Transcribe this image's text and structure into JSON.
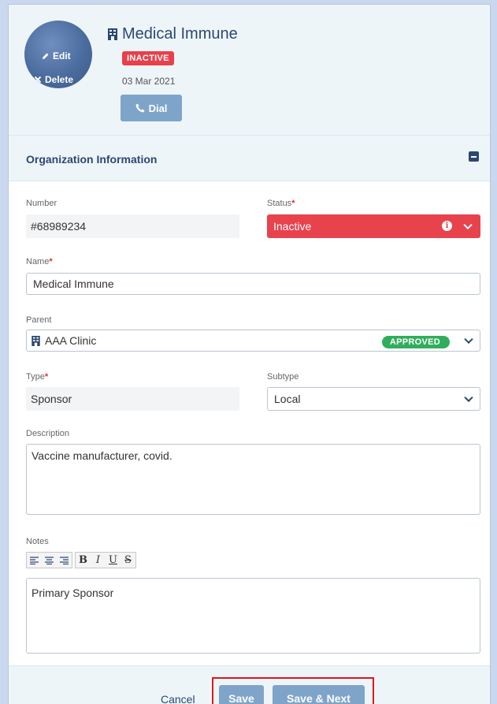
{
  "header": {
    "avatar": {
      "edit_label": "Edit",
      "delete_label": "Delete"
    },
    "org_name": "Medical Immune",
    "status_badge": "INACTIVE",
    "date": "03 Mar 2021",
    "dial_label": "Dial"
  },
  "section": {
    "title": "Organization Information"
  },
  "fields": {
    "number": {
      "label": "Number",
      "value": "#68989234"
    },
    "status": {
      "label": "Status",
      "required_mark": "*",
      "value": "Inactive",
      "info_glyph": "i"
    },
    "name": {
      "label": "Name",
      "required_mark": "*",
      "value": "Medical Immune"
    },
    "parent": {
      "label": "Parent",
      "value": "AAA Clinic",
      "badge": "APPROVED"
    },
    "type": {
      "label": "Type",
      "required_mark": "*",
      "value": "Sponsor"
    },
    "subtype": {
      "label": "Subtype",
      "value": "Local"
    },
    "description": {
      "label": "Description",
      "value": "Vaccine manufacturer, covid."
    },
    "notes": {
      "label": "Notes",
      "value": "Primary Sponsor",
      "toolbar": {
        "bold": "B",
        "italic": "I",
        "underline": "U",
        "strike": "S"
      }
    }
  },
  "footer": {
    "cancel_label": "Cancel",
    "save_label": "Save",
    "save_next_label": "Save & Next"
  },
  "colors": {
    "accent": "#2c4870",
    "button": "#7fa4c9",
    "danger": "#e8434d",
    "success": "#2fae5c",
    "highlight": "#e0161b"
  }
}
